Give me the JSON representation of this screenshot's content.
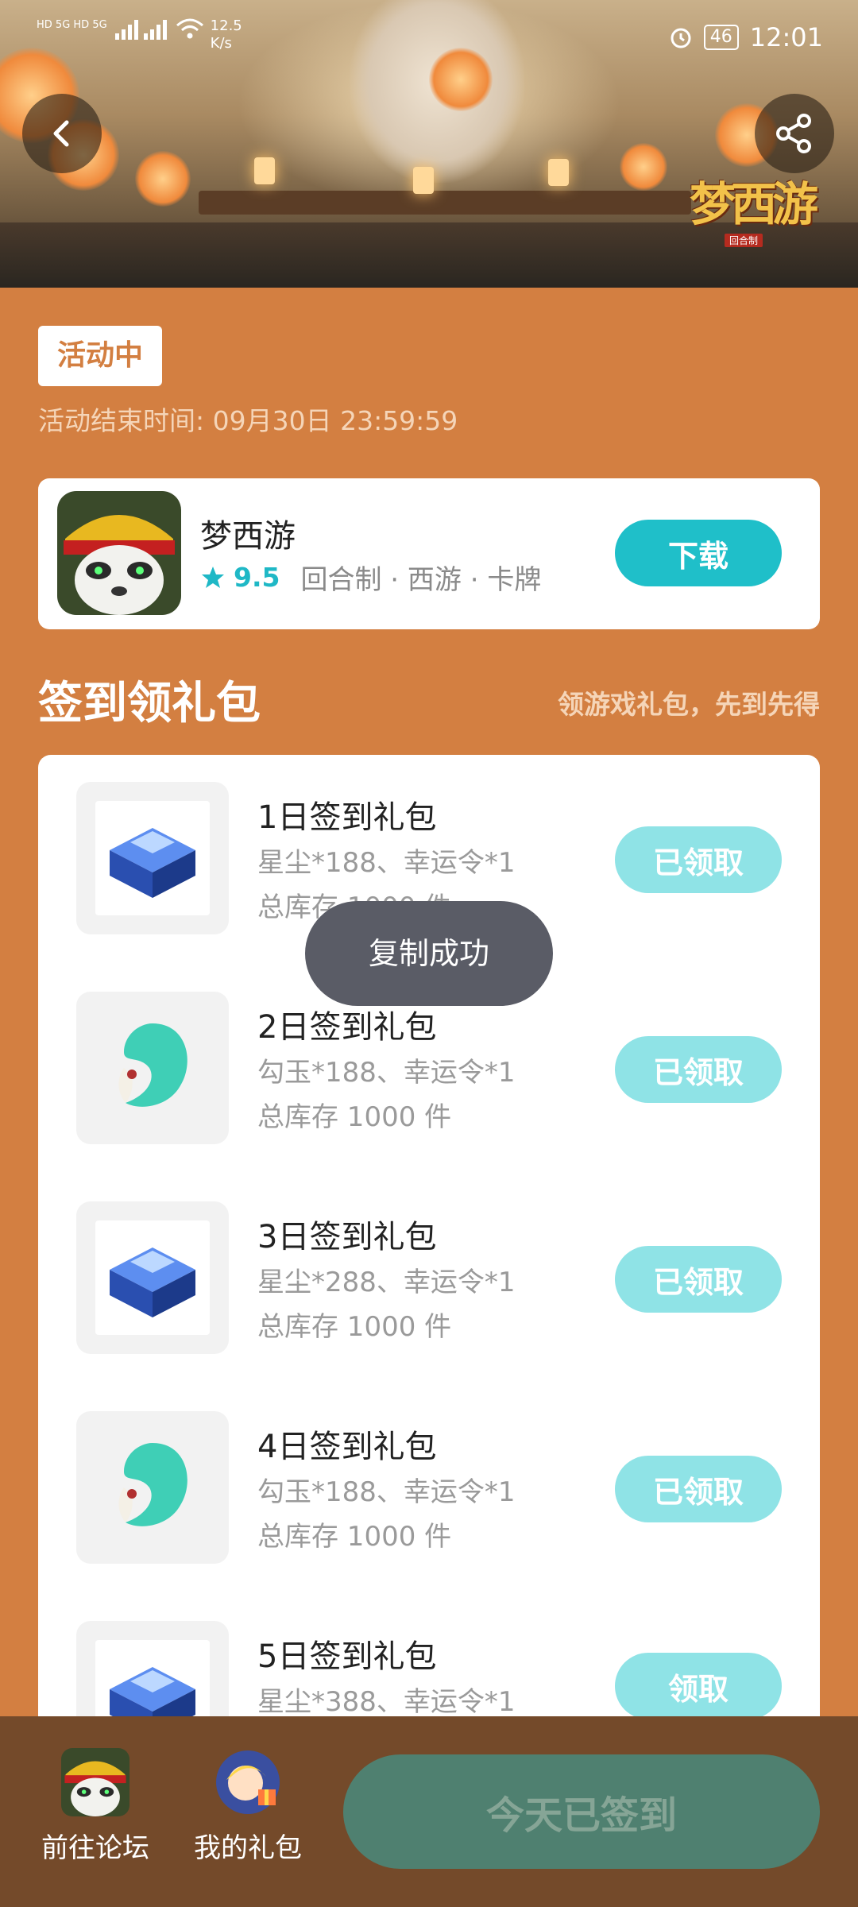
{
  "status_bar": {
    "net_speed_value": "12.5",
    "net_speed_unit": "K/s",
    "battery": "46",
    "time": "12:01",
    "signal_labels": "HD 5G HD 5G"
  },
  "banner": {
    "logo_text": "梦西游",
    "logo_subtitle": "回合制"
  },
  "activity": {
    "status_tag": "活动中",
    "end_time": "活动结束时间: 09月30日 23:59:59"
  },
  "game": {
    "name": "梦西游",
    "score": "9.5",
    "tags": "回合制 · 西游 · 卡牌",
    "download_label": "下载"
  },
  "section": {
    "title": "签到领礼包",
    "subtitle": "领游戏礼包，先到先得"
  },
  "gifts": [
    {
      "title": "1日签到礼包",
      "desc": "星尘*188、幸运令*1",
      "stock": "总库存 1000 件",
      "button": "已领取",
      "icon": "blue-chest-icon"
    },
    {
      "title": "2日签到礼包",
      "desc": "勾玉*188、幸运令*1",
      "stock": "总库存 1000 件",
      "button": "已领取",
      "icon": "jade-magatama-icon"
    },
    {
      "title": "3日签到礼包",
      "desc": "星尘*288、幸运令*1",
      "stock": "总库存 1000 件",
      "button": "已领取",
      "icon": "blue-chest-icon"
    },
    {
      "title": "4日签到礼包",
      "desc": "勾玉*188、幸运令*1",
      "stock": "总库存 1000 件",
      "button": "已领取",
      "icon": "jade-magatama-icon"
    },
    {
      "title": "5日签到礼包",
      "desc": "星尘*388、幸运令*1",
      "stock": "",
      "button": "领取",
      "icon": "blue-chest-icon"
    }
  ],
  "toast": {
    "text": "复制成功"
  },
  "bottom": {
    "forum_label": "前往论坛",
    "gifts_label": "我的礼包",
    "sign_label": "今天已签到"
  },
  "colors": {
    "page_bg": "#d37f41",
    "accent": "#1fbfc9",
    "claimed_btn": "#8fe3e6",
    "bottom_bar": "#744a2a",
    "sign_btn": "#4f8070"
  }
}
